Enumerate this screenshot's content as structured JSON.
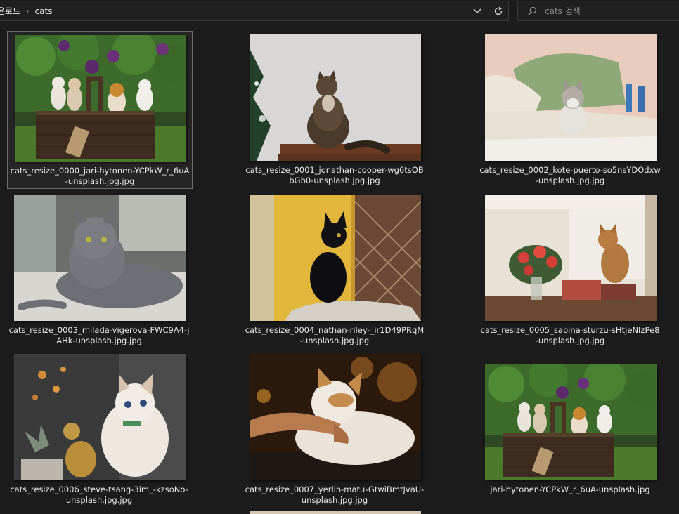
{
  "address_bar": {
    "crumbs": [
      "운로드",
      "cats"
    ],
    "separator": "›"
  },
  "search": {
    "placeholder": "cats 검색"
  },
  "icons": {
    "dropdown": "chevron-down-icon",
    "refresh": "refresh-icon",
    "search": "search-icon"
  },
  "files": [
    {
      "name": "cats_resize_0000_jari-hytonen-YCPkW_r_6uA-unsplash.jpg.jpg",
      "selected": true
    },
    {
      "name": "cats_resize_0001_jonathan-cooper-wg6tsOBbGb0-unsplash.jpg.jpg",
      "selected": false
    },
    {
      "name": "cats_resize_0002_kote-puerto-so5nsYDOdxw-unsplash.jpg.jpg",
      "selected": false
    },
    {
      "name": "cats_resize_0003_milada-vigerova-FWC9A4-jAHk-unsplash.jpg.jpg",
      "selected": false
    },
    {
      "name": "cats_resize_0004_nathan-riley-_ir1D49PRqM-unsplash.jpg.jpg",
      "selected": false
    },
    {
      "name": "cats_resize_0005_sabina-sturzu-sHtJeNIzPe8-unsplash.jpg.jpg",
      "selected": false
    },
    {
      "name": "cats_resize_0006_steve-tsang-3im_-kzsoNo-unsplash.jpg.jpg",
      "selected": false
    },
    {
      "name": "cats_resize_0007_yerlin-matu-GtwiBmtJvaU-unsplash.jpg.jpg",
      "selected": false
    },
    {
      "name": "jari-hytonen-YCPkW_r_6uA-unsplash.jpg",
      "selected": false
    }
  ]
}
